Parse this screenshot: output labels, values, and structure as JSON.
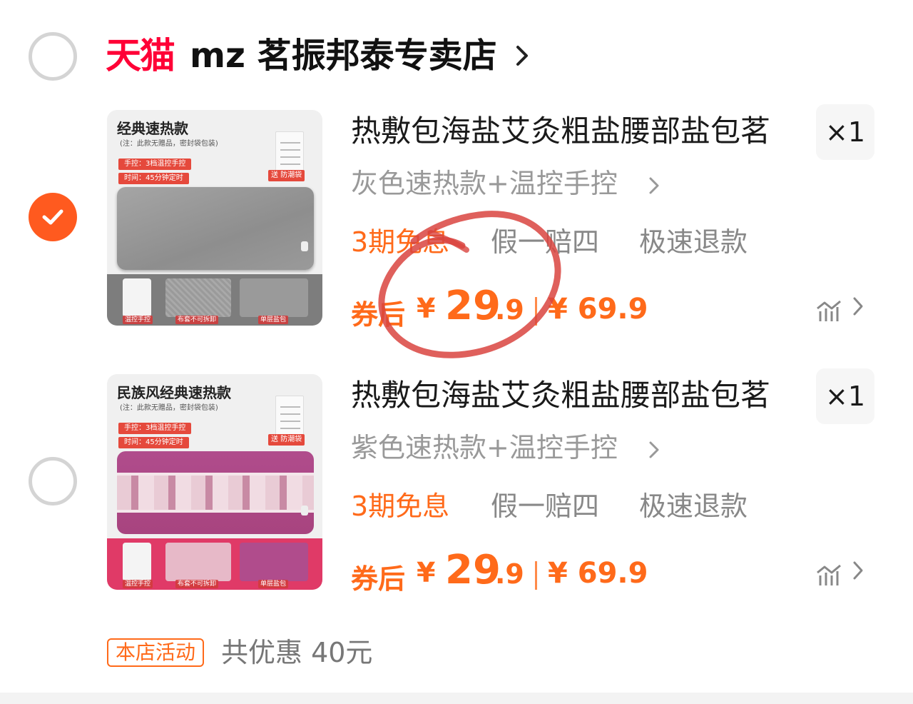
{
  "store": {
    "platform_logo": "天猫",
    "name": "mz 茗振邦泰专卖店"
  },
  "items": [
    {
      "selected": true,
      "thumb": {
        "title": "经典速热款",
        "note": "(注：此款无赠品，密封袋包装)",
        "tag_a": "手控：3档温控手控",
        "tag_b": "时间：45分钟定时",
        "pack_badge": "送 防潮袋",
        "labels": [
          "温控手控",
          "布套不可拆卸",
          "单层盐包"
        ]
      },
      "title": "热敷包海盐艾灸粗盐腰部盐包茗",
      "quantity": "×1",
      "sku": "灰色速热款+温控手控",
      "promos": [
        "3期免息",
        "假一赔四",
        "极速退款"
      ],
      "price": {
        "coupon_label": "券后",
        "currency": "¥",
        "integer": "29",
        "decimal": ".9",
        "original": "¥ 69.9"
      }
    },
    {
      "selected": false,
      "thumb": {
        "title": "民族风经典速热款",
        "note": "(注：此款无赠品，密封袋包装)",
        "tag_a": "手控：3档温控手控",
        "tag_b": "时间：45分钟定时",
        "pack_badge": "送 防潮袋",
        "labels": [
          "温控手控",
          "布套不可拆卸",
          "单层盐包"
        ]
      },
      "title": "热敷包海盐艾灸粗盐腰部盐包茗",
      "quantity": "×1",
      "sku": "紫色速热款+温控手控",
      "promos": [
        "3期免息",
        "假一赔四",
        "极速退款"
      ],
      "price": {
        "coupon_label": "券后",
        "currency": "¥",
        "integer": "29",
        "decimal": ".9",
        "original": "¥ 69.9"
      }
    }
  ],
  "shop_promo": {
    "tag": "本店活动",
    "total": "共优惠 40元"
  },
  "colors": {
    "accent_orange": "#ff6a1a",
    "tmall_red": "#ff0036",
    "annotation_red": "#d9443f"
  },
  "icons": [
    "check-icon",
    "chevron-right-icon",
    "price-trend-icon"
  ]
}
